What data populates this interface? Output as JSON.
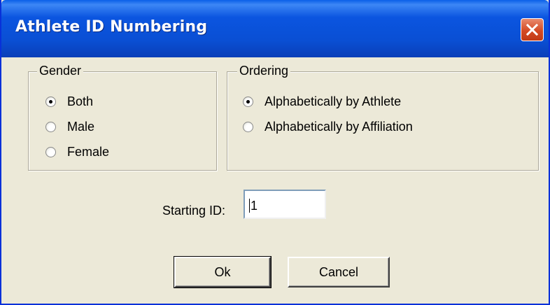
{
  "window": {
    "title": "Athlete ID Numbering"
  },
  "gender": {
    "legend": "Gender",
    "options": [
      {
        "label": "Both",
        "selected": true
      },
      {
        "label": "Male",
        "selected": false
      },
      {
        "label": "Female",
        "selected": false
      }
    ]
  },
  "ordering": {
    "legend": "Ordering",
    "options": [
      {
        "label": "Alphabetically by Athlete",
        "selected": true
      },
      {
        "label": "Alphabetically by Affiliation",
        "selected": false
      }
    ]
  },
  "starting_id": {
    "label": "Starting ID:",
    "value": "1"
  },
  "buttons": {
    "ok": "Ok",
    "cancel": "Cancel"
  },
  "colors": {
    "titlebar": "#0a4fd4",
    "close": "#d44a24",
    "face": "#ece9d8"
  },
  "icons": {
    "close": "close-icon",
    "radio": "radio-icon"
  }
}
